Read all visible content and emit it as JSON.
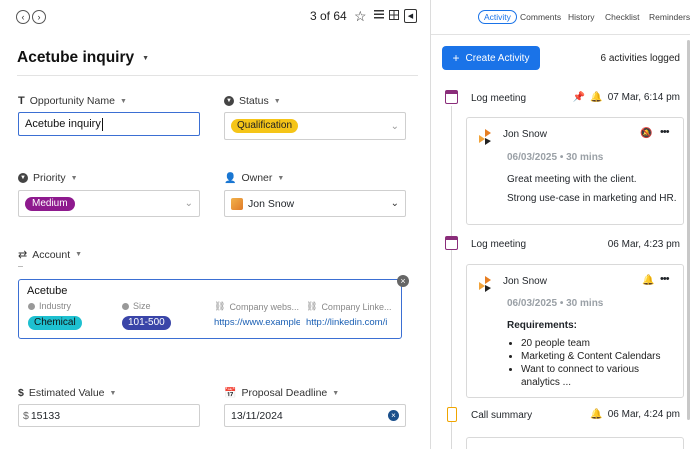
{
  "nav": {
    "position": "3 of 64"
  },
  "record": {
    "title": "Acetube inquiry"
  },
  "fields": {
    "opportunity_name": {
      "label": "Opportunity Name",
      "value": "Acetube inquiry"
    },
    "status": {
      "label": "Status",
      "value": "Qualification"
    },
    "priority": {
      "label": "Priority",
      "value": "Medium"
    },
    "owner": {
      "label": "Owner",
      "value": "Jon Snow"
    },
    "account": {
      "label": "Account"
    },
    "estimated_value": {
      "label": "Estimated Value",
      "currency": "$",
      "value": "15133"
    },
    "proposal_deadline": {
      "label": "Proposal Deadline",
      "value": "13/11/2024"
    }
  },
  "account_card": {
    "name": "Acetube",
    "columns": [
      {
        "label": "Industry",
        "value": "Chemical"
      },
      {
        "label": "Size",
        "value": "101-500"
      },
      {
        "label": "Company webs...",
        "value": "https://www.example"
      },
      {
        "label": "Company Linke...",
        "value": "http://linkedin.com/i"
      }
    ]
  },
  "tabs": [
    "Activity",
    "Comments",
    "History",
    "Checklist",
    "Reminders"
  ],
  "activity": {
    "create_label": "Create Activity",
    "logged_count": "6 activities logged",
    "items": [
      {
        "title": "Log meeting",
        "time": "07 Mar, 6:14 pm",
        "author": "Jon Snow",
        "date_line": "06/03/2025",
        "duration": "30 mins",
        "body": [
          "Great meeting with the client.",
          "Strong use-case in marketing and HR."
        ]
      },
      {
        "title": "Log meeting",
        "time": "06 Mar, 4:23 pm",
        "author": "Jon Snow",
        "date_line": "06/03/2025",
        "duration": "30 mins",
        "heading": "Requirements:",
        "bullets": [
          "20 people team",
          "Marketing & Content Calendars",
          "Want to connect to various analytics ..."
        ]
      },
      {
        "title": "Call summary",
        "time": "06 Mar, 4:24 pm"
      }
    ]
  },
  "colors": {
    "accent": "#1a73e8",
    "qualification": "#f5c518",
    "medium": "#8e1a8e",
    "chemical": "#1ec0d0",
    "size_pill": "#3a45a8"
  }
}
